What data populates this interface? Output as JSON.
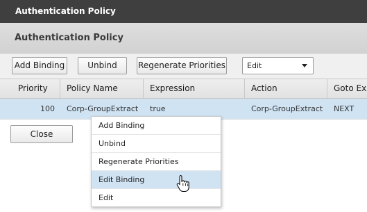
{
  "window": {
    "title": "Authentication Policy"
  },
  "panel": {
    "title": "Authentication Policy"
  },
  "toolbar": {
    "add_binding": "Add Binding",
    "unbind": "Unbind",
    "regenerate": "Regenerate Priorities",
    "edit_select": "Edit"
  },
  "table": {
    "columns": [
      "Priority",
      "Policy Name",
      "Expression",
      "Action",
      "Goto Expression"
    ],
    "rows": [
      {
        "priority": "100",
        "policy_name": "Corp-GroupExtract",
        "expression": "true",
        "action": "Corp-GroupExtract",
        "goto": "NEXT"
      }
    ]
  },
  "close_label": "Close",
  "context_menu": {
    "items": [
      "Add Binding",
      "Unbind",
      "Regenerate Priorities",
      "Edit Binding",
      "Edit"
    ],
    "hovered": "Edit Binding"
  },
  "colors": {
    "titlebar": "#3f3f3f",
    "selected_row": "#cfe3f3",
    "menu_hover": "#cfe3f3"
  },
  "icons": {
    "cursor": "hand-pointer-icon",
    "dropdown": "chevron-down-icon"
  }
}
